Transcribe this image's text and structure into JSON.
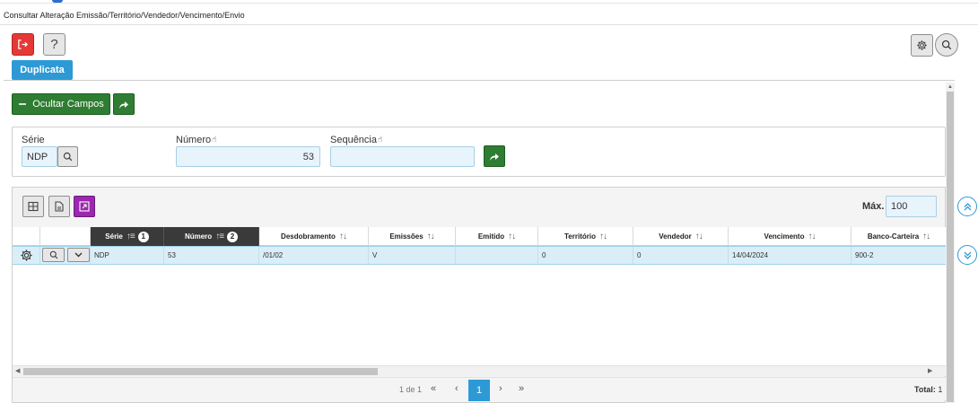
{
  "window": {
    "title": "Consultar Alteração Emissão/Território/Vendedor/Vencimento/Envio"
  },
  "toolbar": {
    "help_label": "?"
  },
  "tabs": [
    {
      "label": "Duplicata",
      "active": true
    }
  ],
  "actions": {
    "hide_fields_label": "Ocultar Campos"
  },
  "filters": {
    "serie": {
      "label": "Série",
      "value": "NDP"
    },
    "numero": {
      "label": "Número",
      "value": "53"
    },
    "sequencia": {
      "label": "Sequência",
      "value": ""
    }
  },
  "grid": {
    "max_label": "Máx.",
    "max_value": "100",
    "columns": [
      {
        "label": "Série",
        "sort_order": "1"
      },
      {
        "label": "Número",
        "sort_order": "2"
      },
      {
        "label": "Desdobramento"
      },
      {
        "label": "Emissões"
      },
      {
        "label": "Emitido"
      },
      {
        "label": "Território"
      },
      {
        "label": "Vendedor"
      },
      {
        "label": "Vencimento"
      },
      {
        "label": "Banco-Carteira"
      }
    ],
    "rows": [
      {
        "serie": "NDP",
        "numero": "53",
        "desdobramento": "/01/02",
        "emissoes": "V",
        "emitido": "",
        "territorio": "0",
        "vendedor": "0",
        "vencimento": "14/04/2024",
        "banco_carteira": "900-2"
      }
    ]
  },
  "pager": {
    "info": "1 de 1",
    "current_page": "1",
    "total_label": "Total:",
    "total_value": "1",
    "first_icon": "«",
    "prev_icon": "‹",
    "next_icon": "›",
    "last_icon": "»"
  },
  "colors": {
    "accent": "#2d9ad6",
    "exit": "#e53935",
    "action_green": "#2e7d32",
    "export_purple": "#9c27b0",
    "header_dark": "#3a3a3a",
    "selected_row": "#daeef8"
  },
  "icons": {
    "exit": "exit-icon",
    "settings": "gear-icon",
    "search": "search-icon",
    "share": "share-arrow-icon",
    "grid_view": "grid-icon",
    "document": "document-icon",
    "export": "export-icon",
    "scroll_up": "chevrons-up-icon",
    "scroll_down": "chevrons-down-icon"
  }
}
